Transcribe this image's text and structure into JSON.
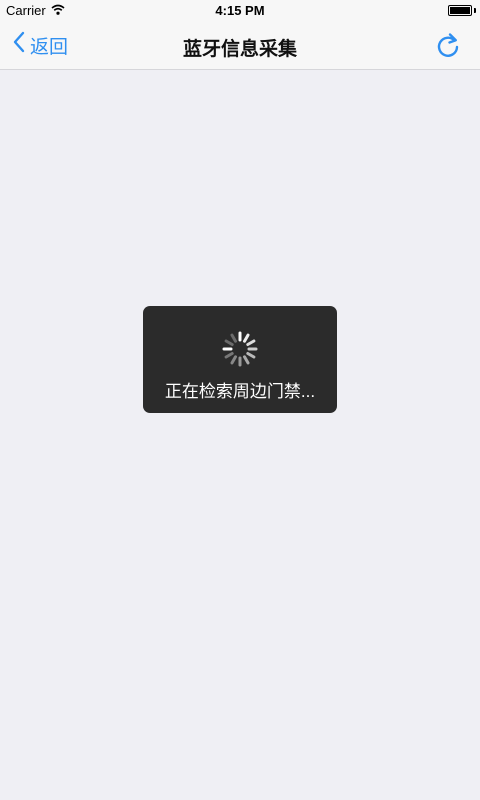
{
  "status_bar": {
    "carrier": "Carrier",
    "time": "4:15 PM",
    "icons": {
      "wifi": "wifi-icon",
      "battery": "battery-icon"
    }
  },
  "nav": {
    "back_label": "返回",
    "title": "蓝牙信息采集",
    "icons": {
      "back": "chevron-left-icon",
      "refresh": "refresh-icon"
    }
  },
  "hud": {
    "message": "正在检索周边门禁...",
    "icon": "loading-spinner-icon"
  },
  "colors": {
    "accent": "#2f8ff0",
    "background": "#efeff4",
    "nav_background": "#f7f7f7",
    "hud_background": "#2b2b2b"
  }
}
